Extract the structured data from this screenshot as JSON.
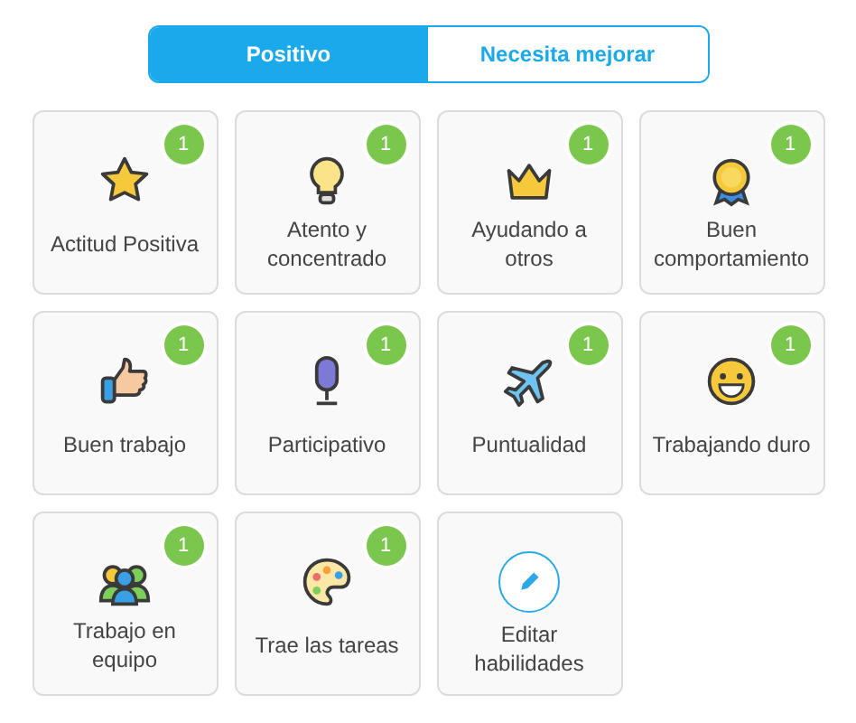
{
  "tabs": [
    {
      "label": "Positivo",
      "selected": true
    },
    {
      "label": "Necesita mejorar",
      "selected": false
    }
  ],
  "skills": [
    {
      "kind": "skill",
      "label": "Actitud Positiva",
      "count": "1"
    },
    {
      "kind": "skill",
      "label": "Atento y concentrado",
      "count": "1"
    },
    {
      "kind": "skill",
      "label": "Ayudando a otros",
      "count": "1"
    },
    {
      "kind": "skill",
      "label": "Buen comportamiento",
      "count": "1"
    },
    {
      "kind": "skill",
      "label": "Buen trabajo",
      "count": "1"
    },
    {
      "kind": "skill",
      "label": "Participativo",
      "count": "1"
    },
    {
      "kind": "skill",
      "label": "Puntualidad",
      "count": "1"
    },
    {
      "kind": "skill",
      "label": "Trabajando duro",
      "count": "1"
    },
    {
      "kind": "skill",
      "label": "Trabajo en equipo",
      "count": "1"
    },
    {
      "kind": "skill",
      "label": "Trae las tareas",
      "count": "1"
    },
    {
      "kind": "edit",
      "label": "Editar habilidades"
    }
  ]
}
